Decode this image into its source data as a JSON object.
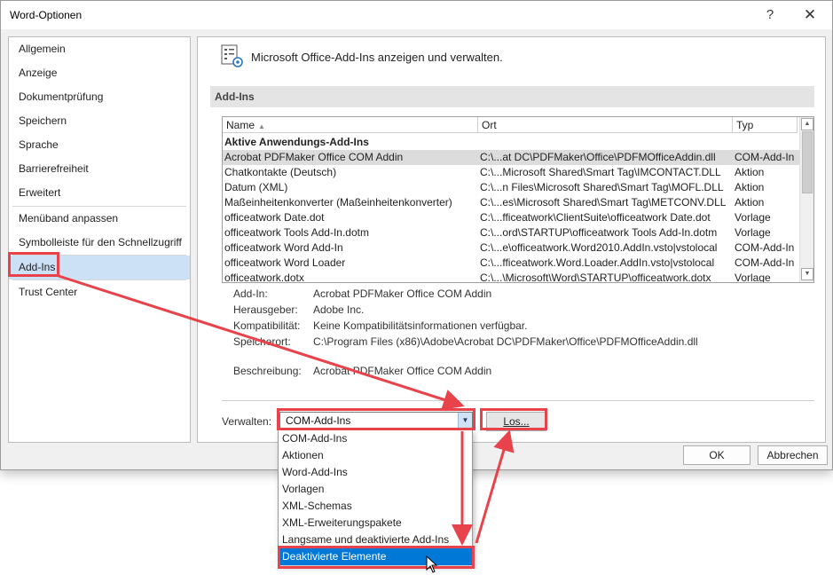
{
  "window": {
    "title": "Word-Optionen",
    "help_glyph": "?",
    "close_glyph": "✕"
  },
  "sidebar": {
    "items": [
      {
        "label": "Allgemein"
      },
      {
        "label": "Anzeige"
      },
      {
        "label": "Dokumentprüfung"
      },
      {
        "label": "Speichern"
      },
      {
        "label": "Sprache"
      },
      {
        "label": "Barrierefreiheit"
      },
      {
        "label": "Erweitert"
      },
      {
        "label": "Menüband anpassen"
      },
      {
        "label": "Symbolleiste für den Schnellzugriff"
      },
      {
        "label": "Add-Ins",
        "selected": true
      },
      {
        "label": "Trust Center"
      }
    ]
  },
  "main": {
    "header": "Microsoft Office-Add-Ins anzeigen und verwalten.",
    "section_title": "Add-Ins",
    "columns": {
      "name": "Name",
      "ort": "Ort",
      "typ": "Typ"
    },
    "group_title": "Aktive Anwendungs-Add-Ins",
    "rows": [
      {
        "name": "Acrobat PDFMaker Office COM Addin",
        "ort": "C:\\...at DC\\PDFMaker\\Office\\PDFMOfficeAddin.dll",
        "typ": "COM-Add-In",
        "selected": true
      },
      {
        "name": "Chatkontakte (Deutsch)",
        "ort": "C:\\...Microsoft Shared\\Smart Tag\\IMCONTACT.DLL",
        "typ": "Aktion"
      },
      {
        "name": "Datum (XML)",
        "ort": "C:\\...n Files\\Microsoft Shared\\Smart Tag\\MOFL.DLL",
        "typ": "Aktion"
      },
      {
        "name": "Maßeinheitenkonverter (Maßeinheitenkonverter)",
        "ort": "C:\\...es\\Microsoft Shared\\Smart Tag\\METCONV.DLL",
        "typ": "Aktion"
      },
      {
        "name": "officeatwork Date.dot",
        "ort": "C:\\...fficeatwork\\ClientSuite\\officeatwork Date.dot",
        "typ": "Vorlage"
      },
      {
        "name": "officeatwork Tools Add-In.dotm",
        "ort": "C:\\...ord\\STARTUP\\officeatwork Tools Add-In.dotm",
        "typ": "Vorlage"
      },
      {
        "name": "officeatwork Word Add-In",
        "ort": "C:\\...e\\officeatwork.Word2010.AddIn.vsto|vstolocal",
        "typ": "COM-Add-In"
      },
      {
        "name": "officeatwork Word Loader",
        "ort": "C:\\...fficeatwork.Word.Loader.AddIn.vsto|vstolocal",
        "typ": "COM-Add-In"
      },
      {
        "name": "officeatwork.dotx",
        "ort": "C:\\...\\Microsoft\\Word\\STARTUP\\officeatwork.dotx",
        "typ": "Vorlage"
      }
    ],
    "details": {
      "addin_label": "Add-In:",
      "addin_value": "Acrobat PDFMaker Office COM Addin",
      "publisher_label": "Herausgeber:",
      "publisher_value": "Adobe Inc.",
      "compat_label": "Kompatibilität:",
      "compat_value": "Keine Kompatibilitätsinformationen verfügbar.",
      "location_label": "Speicherort:",
      "location_value": "C:\\Program Files (x86)\\Adobe\\Acrobat DC\\PDFMaker\\Office\\PDFMOfficeAddin.dll",
      "description_label": "Beschreibung:",
      "description_value": "Acrobat PDFMaker Office COM Addin"
    },
    "manage": {
      "label": "Verwalten:",
      "selected": "COM-Add-Ins",
      "go_label": "Los..."
    }
  },
  "footer": {
    "ok_label": "OK",
    "cancel_label": "Abbrechen"
  },
  "dropdown": {
    "options": [
      {
        "label": "COM-Add-Ins"
      },
      {
        "label": "Aktionen"
      },
      {
        "label": "Word-Add-Ins"
      },
      {
        "label": "Vorlagen"
      },
      {
        "label": "XML-Schemas"
      },
      {
        "label": "XML-Erweiterungspakete"
      },
      {
        "label": "Langsame und deaktivierte Add-Ins"
      },
      {
        "label": "Deaktivierte Elemente",
        "highlighted": true
      }
    ]
  },
  "annotation_color": "#e8424a",
  "selection_color": "#0078d7"
}
